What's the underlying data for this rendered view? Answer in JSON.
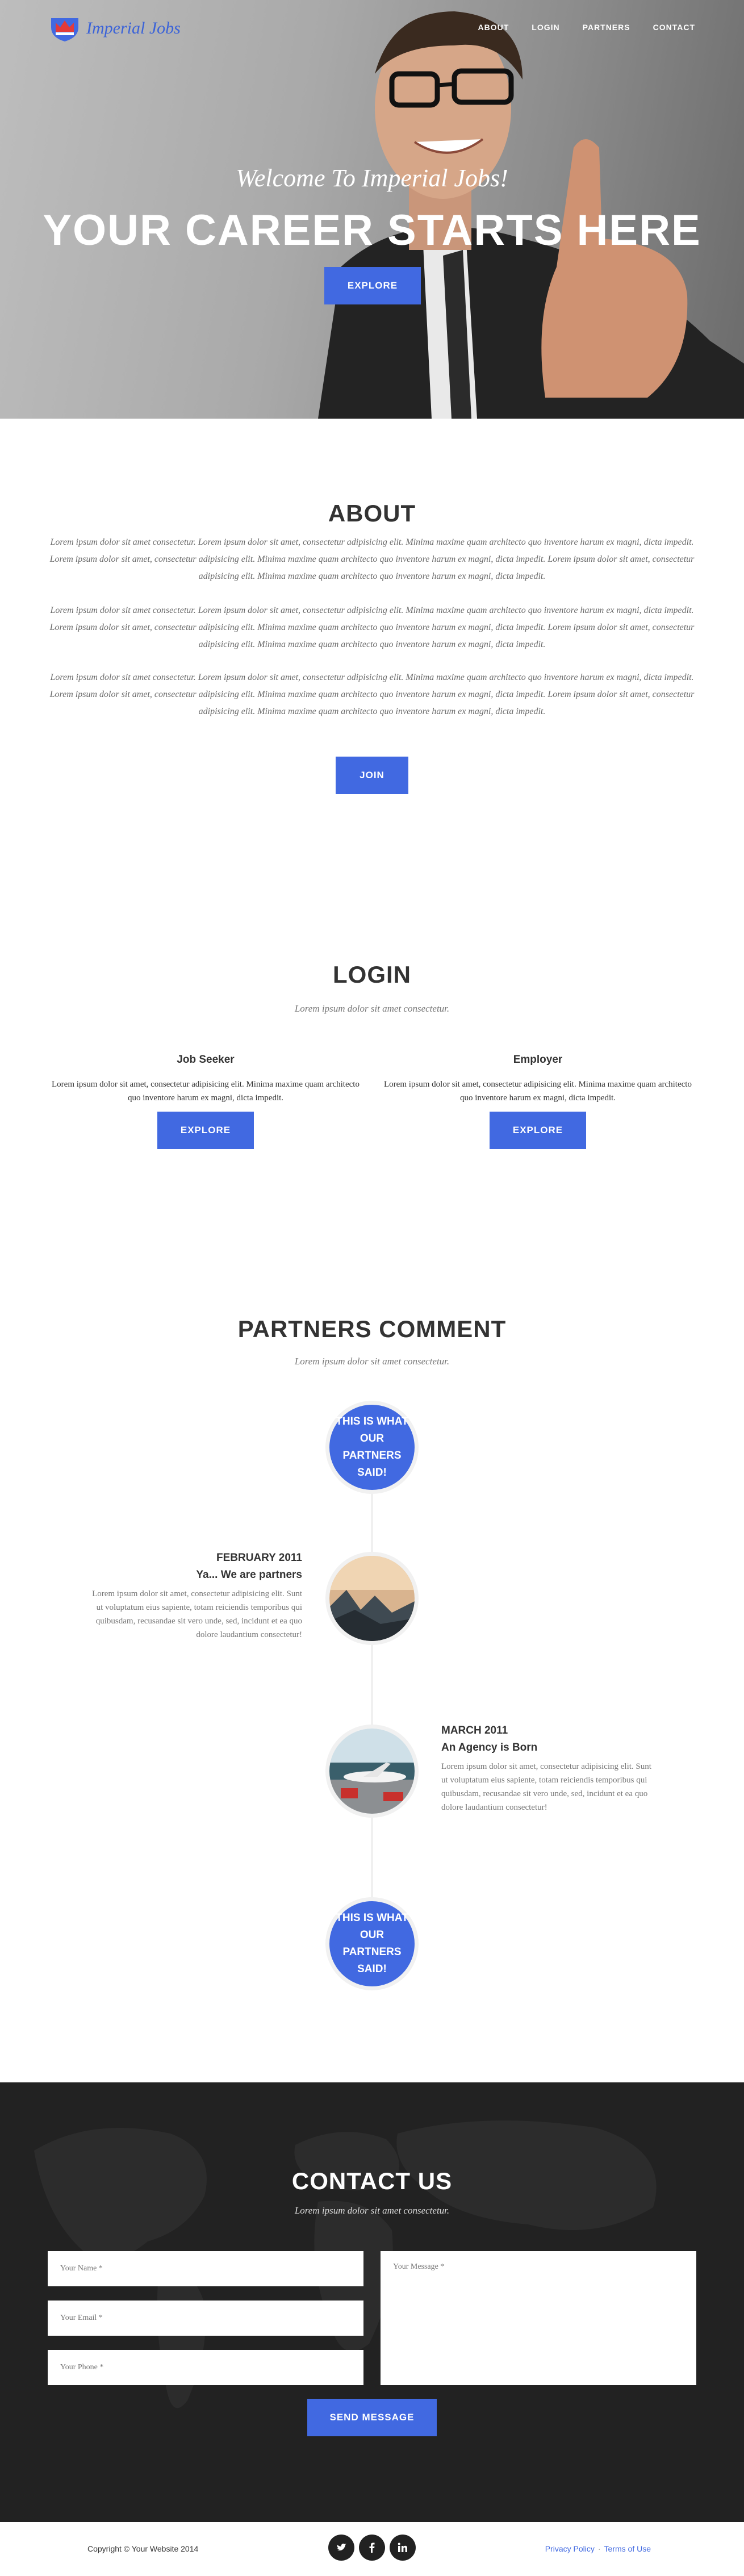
{
  "brand": {
    "name": "Imperial Jobs",
    "accent": "#4169e1",
    "logo_icon": "crown-shield-icon"
  },
  "nav": {
    "items": [
      "ABOUT",
      "LOGIN",
      "PARTNERS",
      "CONTACT"
    ]
  },
  "hero": {
    "welcome": "Welcome To Imperial Jobs!",
    "title": "YOUR CAREER STARTS HERE",
    "button": "EXPLORE"
  },
  "about": {
    "title": "ABOUT",
    "paragraphs": [
      "Lorem ipsum dolor sit amet consectetur. Lorem ipsum dolor sit amet, consectetur adipisicing elit. Minima maxime quam architecto quo inventore harum ex magni, dicta impedit. Lorem ipsum dolor sit amet, consectetur adipisicing elit. Minima maxime quam architecto quo inventore harum ex magni, dicta impedit. Lorem ipsum dolor sit amet, consectetur adipisicing elit. Minima maxime quam architecto quo inventore harum ex magni, dicta impedit.",
      "Lorem ipsum dolor sit amet consectetur. Lorem ipsum dolor sit amet, consectetur adipisicing elit. Minima maxime quam architecto quo inventore harum ex magni, dicta impedit. Lorem ipsum dolor sit amet, consectetur adipisicing elit. Minima maxime quam architecto quo inventore harum ex magni, dicta impedit. Lorem ipsum dolor sit amet, consectetur adipisicing elit. Minima maxime quam architecto quo inventore harum ex magni, dicta impedit.",
      "Lorem ipsum dolor sit amet consectetur. Lorem ipsum dolor sit amet, consectetur adipisicing elit. Minima maxime quam architecto quo inventore harum ex magni, dicta impedit. Lorem ipsum dolor sit amet, consectetur adipisicing elit. Minima maxime quam architecto quo inventore harum ex magni, dicta impedit. Lorem ipsum dolor sit amet, consectetur adipisicing elit. Minima maxime quam architecto quo inventore harum ex magni, dicta impedit."
    ],
    "button": "JOIN"
  },
  "login": {
    "title": "LOGIN",
    "subtitle": "Lorem ipsum dolor sit amet consectetur.",
    "columns": [
      {
        "heading": "Job Seeker",
        "text": "Lorem ipsum dolor sit amet, consectetur adipisicing elit. Minima maxime quam architecto quo inventore harum ex magni, dicta impedit.",
        "button": "EXPLORE"
      },
      {
        "heading": "Employer",
        "text": "Lorem ipsum dolor sit amet, consectetur adipisicing elit. Minima maxime quam architecto quo inventore harum ex magni, dicta impedit.",
        "button": "EXPLORE"
      }
    ]
  },
  "partners": {
    "title": "PARTNERS COMMENT",
    "subtitle": "Lorem ipsum dolor sit amet consectetur.",
    "badge_text": "THIS IS WHAT OUR PARTNERS SAID!",
    "entries": [
      {
        "date": "FEBRUARY 2011",
        "heading": "Ya... We are partners",
        "text": "Lorem ipsum dolor sit amet, consectetur adipisicing elit. Sunt ut voluptatum eius sapiente, totam reiciendis temporibus qui quibusdam, recusandae sit vero unde, sed, incidunt et ea quo dolore laudantium consectetur!"
      },
      {
        "date": "MARCH 2011",
        "heading": "An Agency is Born",
        "text": "Lorem ipsum dolor sit amet, consectetur adipisicing elit. Sunt ut voluptatum eius sapiente, totam reiciendis temporibus qui quibusdam, recusandae sit vero unde, sed, incidunt et ea quo dolore laudantium consectetur!"
      }
    ]
  },
  "contact": {
    "title": "CONTACT US",
    "subtitle": "Lorem ipsum dolor sit amet consectetur.",
    "name_placeholder": "Your Name *",
    "email_placeholder": "Your Email *",
    "phone_placeholder": "Your Phone *",
    "message_placeholder": "Your Message *",
    "button": "SEND MESSAGE"
  },
  "footer": {
    "copyright": "Copyright © Your Website 2014",
    "social_icons": [
      "twitter-icon",
      "facebook-icon",
      "linkedin-icon"
    ],
    "privacy": "Privacy Policy",
    "terms": "Terms of Use"
  }
}
